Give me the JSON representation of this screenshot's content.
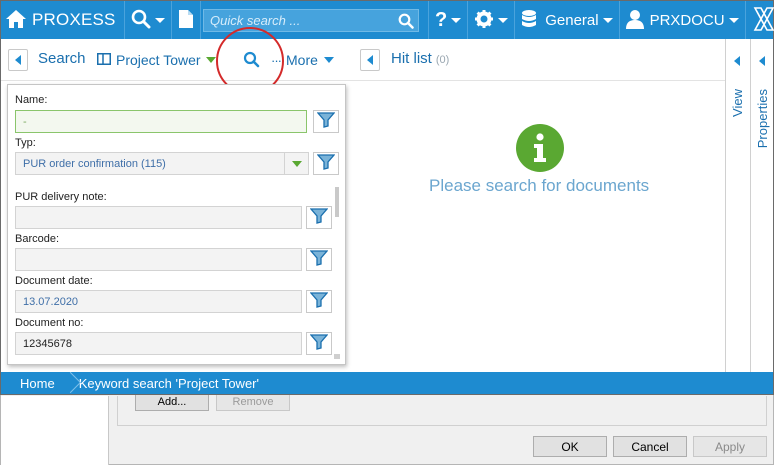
{
  "app": {
    "name": "PROXESS"
  },
  "topbar": {
    "quick_search_placeholder": "Quick search ...",
    "context_label": "General",
    "user_label": "PRXDOCU"
  },
  "toolbar": {
    "search_label": "Search",
    "project_label": "Project Tower",
    "more_label": "More",
    "hitlist_label": "Hit list",
    "hit_count": "(0)"
  },
  "form": {
    "fields": [
      {
        "label": "Name:",
        "value": "-"
      },
      {
        "label": "Typ:",
        "value": "PUR order confirmation (115)"
      },
      {
        "label": "PUR delivery note:",
        "value": ""
      },
      {
        "label": "Barcode:",
        "value": ""
      },
      {
        "label": "Document date:",
        "value": "13.07.2020"
      },
      {
        "label": "Document no:",
        "value": "12345678"
      }
    ]
  },
  "hitlist": {
    "empty_message": "Please search for documents"
  },
  "side_panels": {
    "view_label": "View",
    "properties_label": "Properties"
  },
  "breadcrumb": {
    "home": "Home",
    "current": "Keyword search 'Project Tower'"
  },
  "background_dialog": {
    "add_label": "Add...",
    "remove_label": "Remove",
    "ok_label": "OK",
    "cancel_label": "Cancel",
    "apply_label": "Apply"
  },
  "colors": {
    "accent": "#1e8bd0",
    "green": "#5aa832",
    "highlight_circle": "#d42a2a"
  }
}
